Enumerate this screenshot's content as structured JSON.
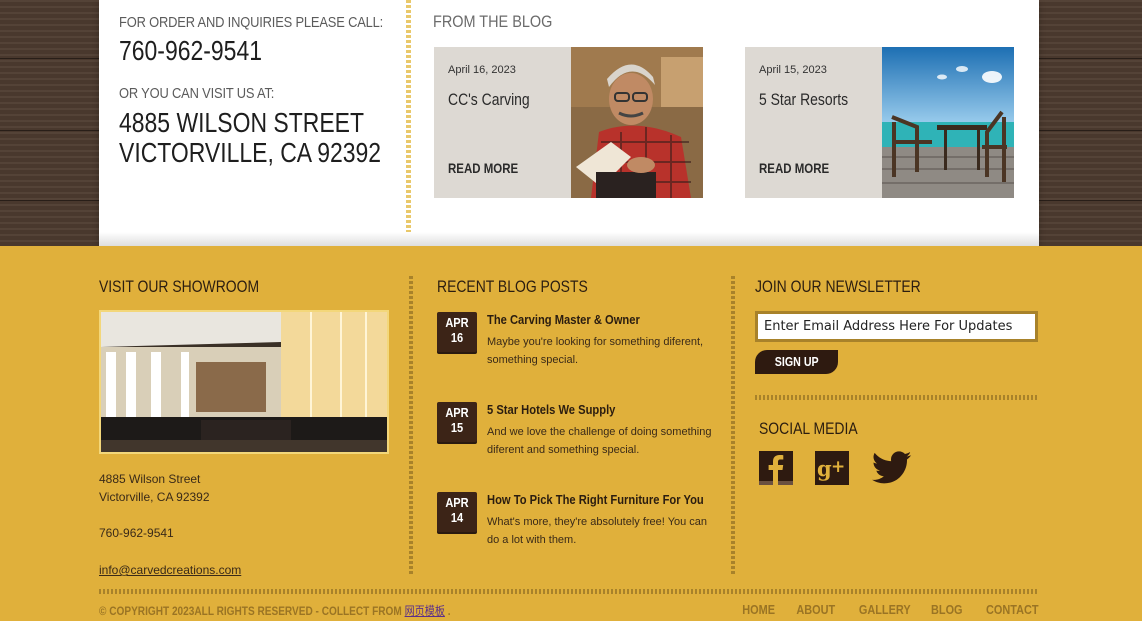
{
  "contact": {
    "order_label": "FOR ORDER AND INQUIRIES PLEASE CALL:",
    "phone": "760-962-9541",
    "visit_label": "OR YOU CAN VISIT US AT:",
    "street": "4885 WILSON STREET",
    "city": "VICTORVILLE, CA 92392"
  },
  "blog": {
    "heading": "FROM THE BLOG",
    "cards": [
      {
        "date": "April 16, 2023",
        "title": "CC's Carving",
        "more": "READ MORE"
      },
      {
        "date": "April 15, 2023",
        "title": "5 Star Resorts",
        "more": "READ MORE"
      }
    ]
  },
  "footer": {
    "showroom": {
      "heading": "VISIT OUR SHOWROOM",
      "street": "4885 Wilson Street",
      "city": "Victorville, CA 92392",
      "phone": "760-962-9541",
      "email": "info@carvedcreations.com"
    },
    "recent": {
      "heading": "RECENT BLOG POSTS",
      "posts": [
        {
          "month": "APR",
          "day": "16",
          "title": "The Carving Master & Owner",
          "text": "Maybe you're looking for something diferent, something special."
        },
        {
          "month": "APR",
          "day": "15",
          "title": "5 Star Hotels We Supply",
          "text": "And we love the challenge of doing something diferent and something special."
        },
        {
          "month": "APR",
          "day": "14",
          "title": "How To Pick The Right Furniture For You",
          "text": "What's more, they're absolutely free! You can do a lot with them."
        }
      ]
    },
    "newsletter": {
      "heading": "JOIN OUR NEWSLETTER",
      "placeholder": "Enter Email Address Here For Updates",
      "signup": "SIGN UP"
    },
    "social": {
      "heading": "SOCIAL MEDIA",
      "icons": [
        "facebook-icon",
        "google-plus-icon",
        "twitter-icon"
      ]
    },
    "copyright": {
      "text": "© COPYRIGHT 2023ALL RIGHTS RESERVED - COLLECT FROM ",
      "link": "网页模板",
      "after": " ."
    },
    "nav": [
      "HOME",
      "ABOUT",
      "GALLERY",
      "BLOG",
      "CONTACT"
    ]
  },
  "colors": {
    "footer_bg": "#e0b03b",
    "badge_bg": "#3c2417",
    "accent_text": "#9a7424"
  }
}
